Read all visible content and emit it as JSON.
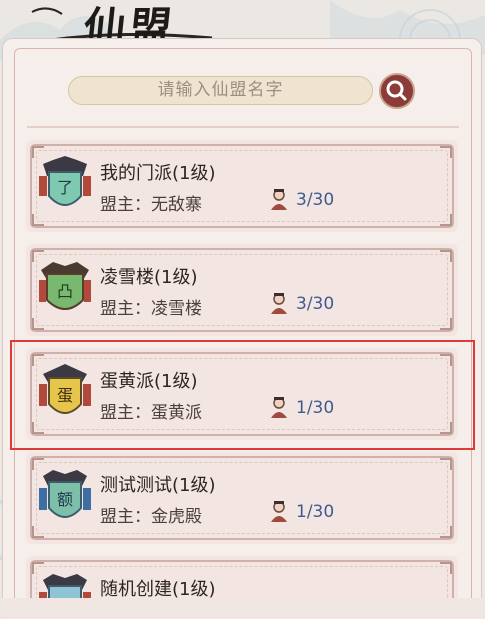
{
  "header": {
    "title": "仙盟"
  },
  "search": {
    "placeholder": "请输入仙盟名字",
    "button_icon": "search-icon"
  },
  "guilds": [
    {
      "name": "我的门派(1级)",
      "leader": "盟主：无敌寨",
      "members": "3/30",
      "emblem_char": "了",
      "emblem_color": "#7ec9b0",
      "selected": false
    },
    {
      "name": "凌雪楼(1级)",
      "leader": "盟主：凌雪楼",
      "members": "3/30",
      "emblem_char": "凸",
      "emblem_color": "#79b86f",
      "selected": false
    },
    {
      "name": "蛋黄派(1级)",
      "leader": "盟主：蛋黄派",
      "members": "1/30",
      "emblem_char": "蛋",
      "emblem_color": "#e6c64a",
      "selected": true
    },
    {
      "name": "测试测试(1级)",
      "leader": "盟主：金虎殿",
      "members": "1/30",
      "emblem_char": "额",
      "emblem_color": "#7dbfa8",
      "selected": false
    },
    {
      "name": "随机创建(1级)",
      "leader": "",
      "members": "",
      "emblem_char": "",
      "emblem_color": "#8fc3d6",
      "selected": false
    }
  ],
  "colors": {
    "selected_outline": "#e03a36",
    "member_count": "#3f5c8f",
    "search_button": "#8c3b38"
  }
}
